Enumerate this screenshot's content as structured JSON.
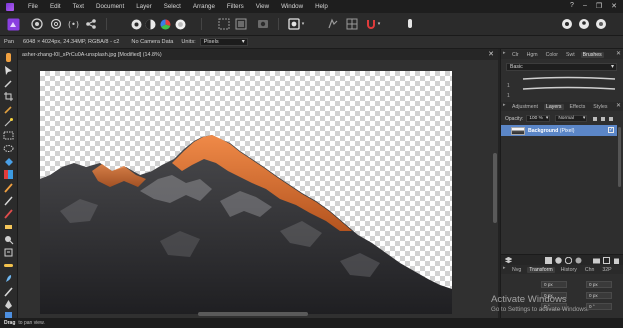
{
  "menubar": {
    "items": [
      "File",
      "Edit",
      "Text",
      "Document",
      "Layer",
      "Select",
      "Arrange",
      "Filters",
      "View",
      "Window",
      "Help"
    ],
    "window_controls": [
      "?",
      "–",
      "❐",
      "✕"
    ]
  },
  "toolbar": {
    "icons": [
      "persona-photo-icon",
      "liquify-persona-icon",
      "develop-persona-icon",
      "tone-mapping-persona-icon",
      "export-persona-icon",
      "color-wheel-icon",
      "contrast-icon",
      "color-balance-icon",
      "hsl-icon",
      "selection-mode-icon",
      "selection-mode-icon",
      "quick-mask-icon",
      "mask-icon",
      "snap-icon",
      "assistant-icon",
      "user-icon",
      "help-icon"
    ]
  },
  "contextbar": {
    "tool": "Pan",
    "doc_info": "6048 × 4024px, 24.34MP, RGBA/8 - c2",
    "camera": "No Camera Data",
    "units_label": "Units:",
    "units_value": "Pixels"
  },
  "document": {
    "tab_title": "asher-zhang-I0I_sPrCu0A-unsplash.jpg [Modified] (14.8%)",
    "close": "✕"
  },
  "panels": {
    "top_tabs": [
      "Clr",
      "Hgm",
      "Color",
      "Swt",
      "Brushes"
    ],
    "top_active": "Brushes",
    "brush_category": "Basic",
    "brush_sizes": [
      "1",
      "1"
    ],
    "mid_tabs": [
      "Adjustment",
      "Layers",
      "Effects",
      "Styles"
    ],
    "mid_active": "Layers",
    "opacity_label": "Opacity:",
    "opacity_value": "100 %",
    "blend_mode": "Normal",
    "layer_name": "Background",
    "layer_type": "(Pixel)",
    "bottom_tabs": [
      "Nvg",
      "Transform",
      "History",
      "Chn",
      "32P"
    ],
    "bottom_active": "Transform",
    "transform_values": [
      "0 px",
      "0 px",
      "0 px",
      "0 px",
      "0 °",
      "0 °"
    ]
  },
  "statusbar": {
    "bold": "Drag",
    "text": "to pan view."
  },
  "watermark": {
    "title": "Activate Windows",
    "subtitle": "Go to Settings to activate Windows."
  },
  "colors": {
    "accent": "#5b86c7",
    "rock_dark": "#2f2f31",
    "peak_light": "#e07a3a"
  }
}
